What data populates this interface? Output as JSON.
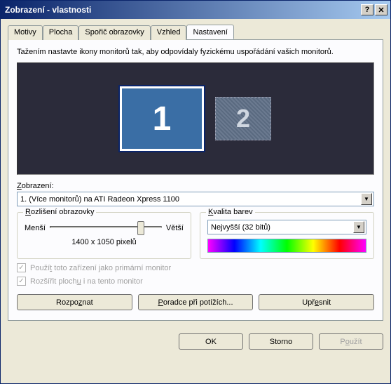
{
  "window": {
    "title": "Zobrazení - vlastnosti"
  },
  "tabs": [
    {
      "label": "Motivy"
    },
    {
      "label": "Plocha"
    },
    {
      "label": "Spořič obrazovky"
    },
    {
      "label": "Vzhled"
    },
    {
      "label": "Nastavení"
    }
  ],
  "instruction": "Tažením nastavte ikony monitorů tak, aby odpovídaly fyzickému uspořádání vašich monitorů.",
  "monitors": {
    "m1": "1",
    "m2": "2"
  },
  "display_label": "Zobrazení:",
  "display_value": "1. (Více monitorů) na ATI Radeon Xpress 1100",
  "resolution": {
    "group_title": "Rozlišení obrazovky",
    "min_label": "Menší",
    "max_label": "Větší",
    "value_text": "1400 x 1050 pixelů"
  },
  "color": {
    "group_title": "Kvalita barev",
    "value": "Nejvyšší (32 bitů)"
  },
  "checkbox1": "Použít toto zařízení jako primární monitor",
  "checkbox2": "Rozšířit plochu i na tento monitor",
  "buttons": {
    "identify": "Rozpoznat",
    "troubleshoot": "Poradce při potížích...",
    "advanced": "Upřesnit"
  },
  "dialog_buttons": {
    "ok": "OK",
    "cancel": "Storno",
    "apply": "Použít"
  }
}
